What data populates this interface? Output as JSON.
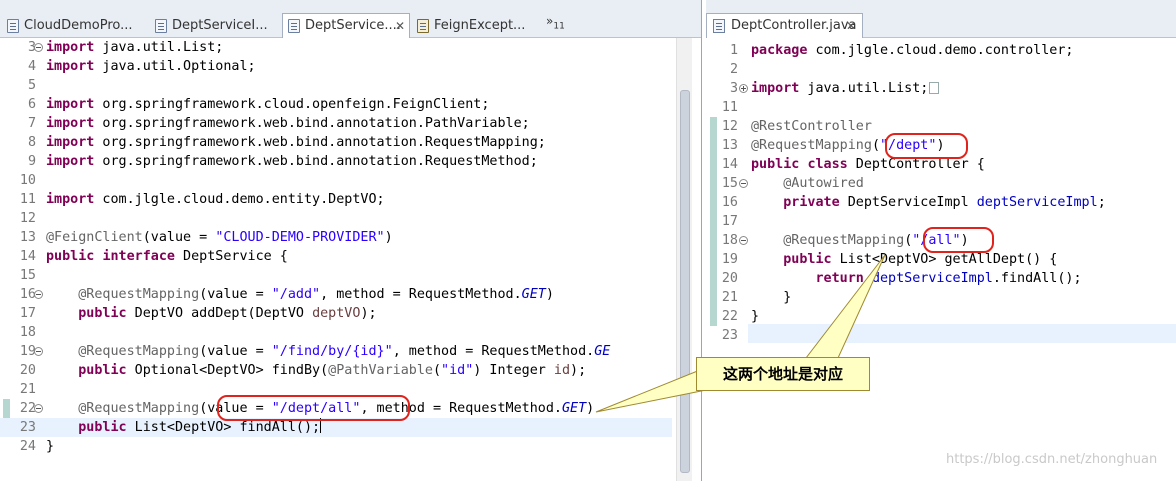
{
  "left_tabs": [
    {
      "label": "CloudDemoPro...",
      "icon": "java-file-icon"
    },
    {
      "label": "DeptServiceI...",
      "icon": "java-file-icon"
    },
    {
      "label": "DeptService....",
      "icon": "java-file-icon",
      "close": "✕"
    },
    {
      "label": "FeignExcept...",
      "icon": "class-file-icon"
    }
  ],
  "overflow_label": "»",
  "overflow_count": "11",
  "left_lines": [
    {
      "n": "3",
      "fold": "minus",
      "html": "<span class=\"kw\">import</span> java.util.List;"
    },
    {
      "n": "4",
      "html": "<span class=\"kw\">import</span> java.util.Optional;"
    },
    {
      "n": "5",
      "html": ""
    },
    {
      "n": "6",
      "html": "<span class=\"kw\">import</span> org.springframework.cloud.openfeign.FeignClient;"
    },
    {
      "n": "7",
      "html": "<span class=\"kw\">import</span> org.springframework.web.bind.annotation.PathVariable;"
    },
    {
      "n": "8",
      "html": "<span class=\"kw\">import</span> org.springframework.web.bind.annotation.RequestMapping;"
    },
    {
      "n": "9",
      "html": "<span class=\"kw\">import</span> org.springframework.web.bind.annotation.RequestMethod;"
    },
    {
      "n": "10",
      "html": ""
    },
    {
      "n": "11",
      "html": "<span class=\"kw\">import</span> com.jlgle.cloud.demo.entity.DeptVO;"
    },
    {
      "n": "12",
      "html": ""
    },
    {
      "n": "13",
      "html": "<span class=\"ann\">@FeignClient</span>(value = <span class=\"str\">\"CLOUD-DEMO-PROVIDER\"</span>)"
    },
    {
      "n": "14",
      "html": "<span class=\"kw\">public</span> <span class=\"kw\">interface</span> DeptService {"
    },
    {
      "n": "15",
      "html": ""
    },
    {
      "n": "16",
      "fold": "minus",
      "html": "    <span class=\"ann\">@RequestMapping</span>(value = <span class=\"str\">\"/add\"</span>, method = RequestMethod.<span class=\"fld it\">GET</span>)"
    },
    {
      "n": "17",
      "html": "    <span class=\"kw\">public</span> DeptVO addDept(DeptVO <span class=\"fld\" style=\"color:#6a3e3e\">deptVO</span>);"
    },
    {
      "n": "18",
      "html": ""
    },
    {
      "n": "19",
      "fold": "minus",
      "html": "    <span class=\"ann\">@RequestMapping</span>(value = <span class=\"str\">\"/find/by/{id}\"</span>, method = RequestMethod.<span class=\"fld it\">GE</span>"
    },
    {
      "n": "20",
      "html": "    <span class=\"kw\">public</span> Optional&lt;DeptVO&gt; findBy(<span class=\"ann\">@PathVariable</span>(<span class=\"str\">\"id\"</span>) Integer <span style=\"color:#6a3e3e\">id</span>);"
    },
    {
      "n": "21",
      "html": ""
    },
    {
      "n": "22",
      "fold": "minus",
      "html": "    <span class=\"ann\">@RequestMapping</span>(value = <span class=\"str\">\"/dept/all\"</span>, method = RequestMethod.<span class=\"fld it\">GET</span>)"
    },
    {
      "n": "23",
      "cur": true,
      "html": "    <span class=\"kw\">public</span> List&lt;DeptVO&gt; findAll();<span class=\"caret\"></span>"
    },
    {
      "n": "24",
      "html": "}"
    }
  ],
  "right_tab": {
    "label": "DeptController.java",
    "close": "✕"
  },
  "right_lines": [
    {
      "n": "1",
      "html": "<span class=\"kw\">package</span> com.jlgle.cloud.demo.controller;"
    },
    {
      "n": "2",
      "html": ""
    },
    {
      "n": "3",
      "fold": "plus",
      "html": "<span class=\"kw\">import</span> java.util.List;<span class=\"collapsed-box\"></span>"
    },
    {
      "n": "11",
      "html": ""
    },
    {
      "n": "12",
      "html": "<span class=\"ann\">@RestController</span>"
    },
    {
      "n": "13",
      "html": "<span class=\"ann\">@RequestMapping</span>(<span class=\"str\">\"/dept\"</span>)"
    },
    {
      "n": "14",
      "html": "<span class=\"kw\">public</span> <span class=\"kw\">class</span> DeptController {"
    },
    {
      "n": "15",
      "fold": "minus",
      "html": "    <span class=\"ann\">@Autowired</span>"
    },
    {
      "n": "16",
      "html": "    <span class=\"kw\">private</span> DeptServiceImpl <span class=\"fld\">deptServiceImpl</span>;"
    },
    {
      "n": "17",
      "html": ""
    },
    {
      "n": "18",
      "fold": "minus",
      "html": "    <span class=\"ann\">@RequestMapping</span>(<span class=\"str\">\"/all\"</span>)"
    },
    {
      "n": "19",
      "html": "    <span class=\"kw\">public</span> List&lt;DeptVO&gt; getAllDept() {"
    },
    {
      "n": "20",
      "html": "        <span class=\"kw\">return</span> <span class=\"fld\">deptServiceImpl</span>.findAll();"
    },
    {
      "n": "21",
      "html": "    }"
    },
    {
      "n": "22",
      "html": "}"
    },
    {
      "n": "23",
      "html": ""
    }
  ],
  "callout_text": "这两个地址是对应",
  "watermark": "https://blog.csdn.net/zhonghuan",
  "colors": {
    "highlight_ellipse": "#e0231c",
    "callout_bg": "#ffffc4",
    "keyword": "#7f0055",
    "string": "#2a00ff"
  }
}
